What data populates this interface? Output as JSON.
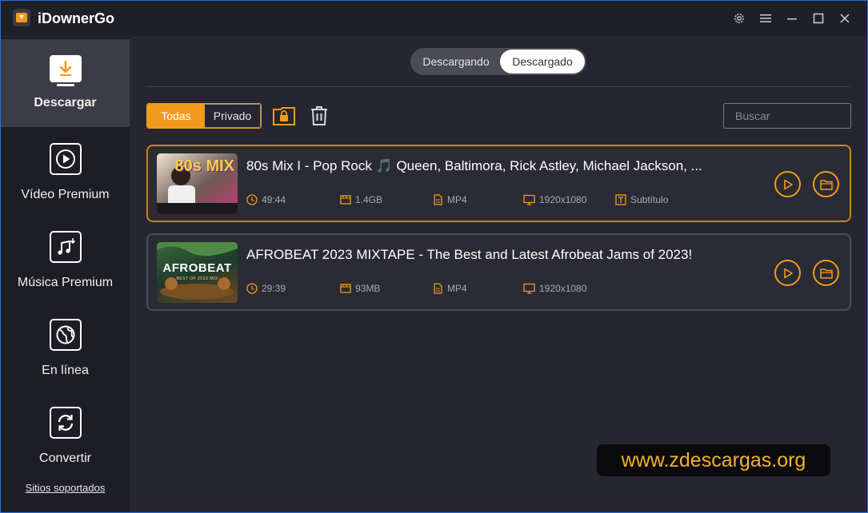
{
  "app": {
    "title": "iDownerGo"
  },
  "sidebar": {
    "items": [
      {
        "label": "Descargar",
        "icon": "download-icon",
        "active": true
      },
      {
        "label": "Vídeo Premium",
        "icon": "play-icon"
      },
      {
        "label": "Música Premium",
        "icon": "music-icon"
      },
      {
        "label": "En línea",
        "icon": "globe-icon"
      },
      {
        "label": "Convertir",
        "icon": "convert-icon"
      }
    ],
    "footer_link": "Sitios soportados"
  },
  "tabs": {
    "downloading": "Descargando",
    "downloaded": "Descargado",
    "selected": "Descargado"
  },
  "filter": {
    "all": "Todas",
    "private": "Privado",
    "selected": "Todas"
  },
  "search": {
    "placeholder": "Buscar",
    "value": ""
  },
  "items": [
    {
      "title": "80s Mix I - Pop Rock 🎵 Queen, Baltimora, Rick Astley, Michael Jackson, ...",
      "thumb_text": "80s MIX",
      "duration": "49:44",
      "size": "1.4GB",
      "format": "MP4",
      "resolution": "1920x1080",
      "subtitle": "Subtítulo"
    },
    {
      "title": "AFROBEAT 2023 MIXTAPE - The Best and Latest Afrobeat Jams of 2023!",
      "thumb_text": "AFROBEAT",
      "thumb_sub": "BEST OF 2023 MIX",
      "duration": "29:39",
      "size": "93MB",
      "format": "MP4",
      "resolution": "1920x1080"
    }
  ],
  "watermark": "www.zdescargas.org",
  "colors": {
    "accent": "#f39a1e",
    "sidebar_bg": "#1d1e25",
    "main_bg": "#25262f",
    "card_bg": "#2a2b34",
    "selected_border": "#c9821f"
  }
}
